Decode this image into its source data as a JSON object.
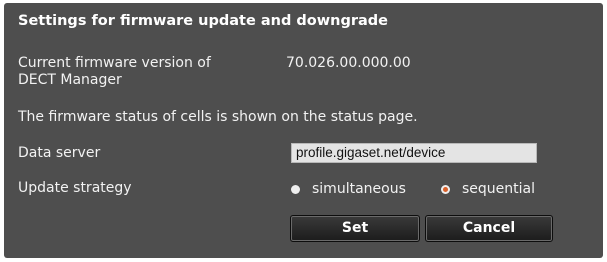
{
  "section_title": "Settings for firmware update and downgrade",
  "firmware": {
    "label_line1": "Current firmware version of",
    "label_line2": "DECT Manager",
    "value": "70.026.00.000.00"
  },
  "status_note": "The firmware status of cells is shown on the status page.",
  "data_server": {
    "label": "Data server",
    "value": "profile.gigaset.net/device"
  },
  "update_strategy": {
    "label": "Update strategy",
    "options": [
      {
        "label": "simultaneous",
        "selected": false
      },
      {
        "label": "sequential",
        "selected": true
      }
    ]
  },
  "buttons": {
    "set": "Set",
    "cancel": "Cancel"
  }
}
